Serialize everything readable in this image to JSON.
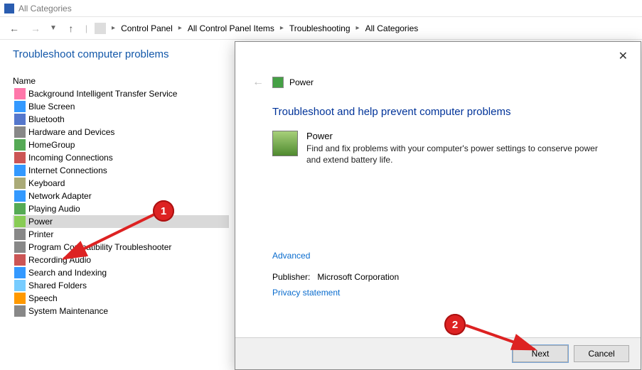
{
  "titlebar": {
    "text": "All Categories"
  },
  "nav": {
    "breadcrumb": [
      "Control Panel",
      "All Control Panel Items",
      "Troubleshooting",
      "All Categories"
    ]
  },
  "left": {
    "heading": "Troubleshoot computer problems",
    "name_label": "Name",
    "items": [
      "Background Intelligent Transfer Service",
      "Blue Screen",
      "Bluetooth",
      "Hardware and Devices",
      "HomeGroup",
      "Incoming Connections",
      "Internet Connections",
      "Keyboard",
      "Network Adapter",
      "Playing Audio",
      "Power",
      "Printer",
      "Program Compatibility Troubleshooter",
      "Recording Audio",
      "Search and Indexing",
      "Shared Folders",
      "Speech",
      "System Maintenance"
    ],
    "selected_index": 10
  },
  "dialog": {
    "header_icon_label": "Power",
    "title": "Troubleshoot and help prevent computer problems",
    "section_name": "Power",
    "section_desc": "Find and fix problems with your computer's power settings to conserve power and extend battery life.",
    "advanced": "Advanced",
    "publisher_label": "Publisher:",
    "publisher_value": "Microsoft Corporation",
    "privacy": "Privacy statement",
    "next": "Next",
    "cancel": "Cancel"
  },
  "annotations": {
    "badge1": "1",
    "badge2": "2"
  }
}
